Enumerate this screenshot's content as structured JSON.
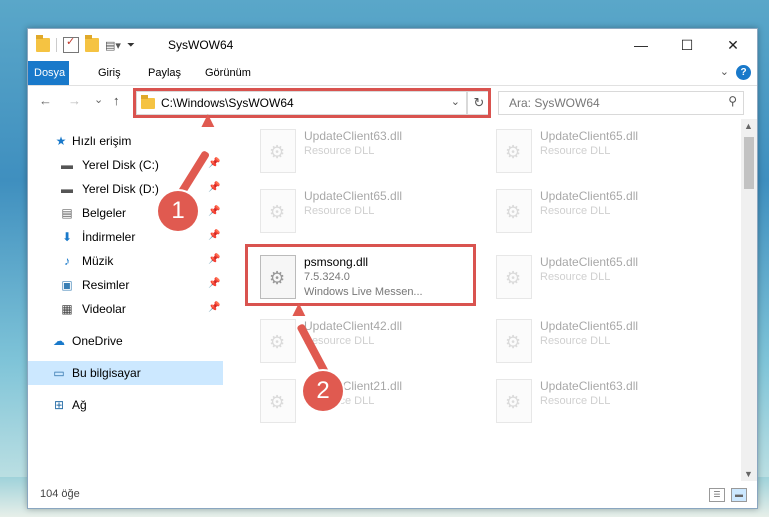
{
  "window": {
    "title": "SysWOW64",
    "controls": {
      "minimize": "—",
      "maximize": "☐",
      "close": "✕"
    }
  },
  "ribbon": {
    "tabs": [
      "Dosya",
      "Giriş",
      "Paylaş",
      "Görünüm"
    ],
    "active_tab": "Dosya",
    "help": "?"
  },
  "nav": {
    "back": "←",
    "forward": "→",
    "recent": "⌄",
    "up": "↑",
    "address": "C:\\Windows\\SysWOW64",
    "search_placeholder": "Ara: SysWOW64"
  },
  "sidebar": {
    "items": [
      {
        "label": "Hızlı erişim",
        "icon": "star-icon",
        "pinned": false
      },
      {
        "label": "Yerel Disk (C:)",
        "icon": "drive-icon",
        "pinned": true
      },
      {
        "label": "Yerel Disk (D:)",
        "icon": "drive-icon",
        "pinned": true
      },
      {
        "label": "Belgeler",
        "icon": "document-icon",
        "pinned": true
      },
      {
        "label": "İndirmeler",
        "icon": "download-icon",
        "pinned": true
      },
      {
        "label": "Müzik",
        "icon": "music-icon",
        "pinned": true
      },
      {
        "label": "Resimler",
        "icon": "pictures-icon",
        "pinned": true
      },
      {
        "label": "Videolar",
        "icon": "video-icon",
        "pinned": true
      },
      {
        "label": "OneDrive",
        "icon": "cloud-icon",
        "pinned": false
      },
      {
        "label": "Bu bilgisayar",
        "icon": "computer-icon",
        "pinned": false,
        "selected": true
      },
      {
        "label": "Ağ",
        "icon": "network-icon",
        "pinned": false
      }
    ]
  },
  "files": {
    "left": [
      {
        "name": "UpdateClient63.dll",
        "desc": "Resource DLL"
      },
      {
        "name": "UpdateClient65.dll",
        "desc": "Resource DLL"
      },
      {
        "name": "psmsong.dll",
        "desc": "7.5.324.0",
        "desc2": "Windows Live Messen...",
        "highlighted": true
      },
      {
        "name": "UpdateClient42.dll",
        "desc": "Resource DLL"
      },
      {
        "name": "UpdateClient21.dll",
        "desc": "Resource DLL"
      }
    ],
    "right": [
      {
        "name": "UpdateClient65.dll",
        "desc": "Resource DLL"
      },
      {
        "name": "UpdateClient65.dll",
        "desc": "Resource DLL"
      },
      {
        "name": "UpdateClient65.dll",
        "desc": "Resource DLL"
      },
      {
        "name": "UpdateClient65.dll",
        "desc": "Resource DLL"
      },
      {
        "name": "UpdateClient63.dll",
        "desc": "Resource DLL"
      }
    ]
  },
  "status": {
    "count": "104 öğe"
  },
  "annotations": {
    "step1": "1",
    "step2": "2"
  },
  "colors": {
    "accent": "#1979ca",
    "annotation": "#e05a50",
    "selected": "#cce8ff"
  }
}
